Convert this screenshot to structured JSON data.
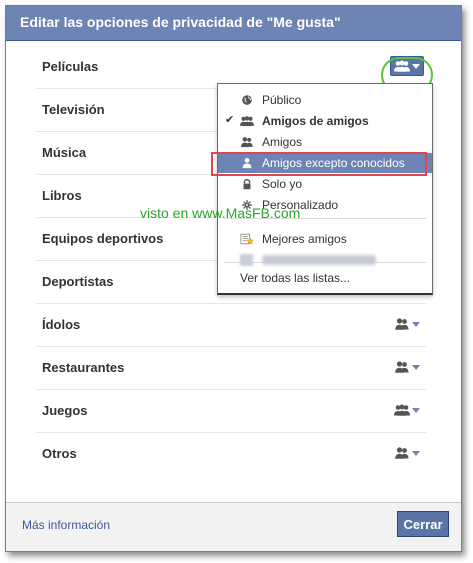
{
  "dialog": {
    "title": "Editar las opciones de privacidad de \"Me gusta\""
  },
  "rows": [
    {
      "label": "Películas",
      "icon": "friends-of-friends-icon"
    },
    {
      "label": "Televisión",
      "icon": "friends-of-friends-icon"
    },
    {
      "label": "Música",
      "icon": "friends-of-friends-icon"
    },
    {
      "label": "Libros",
      "icon": "friends-of-friends-icon"
    },
    {
      "label": "Equipos deportivos",
      "icon": "friends-of-friends-icon"
    },
    {
      "label": "Deportistas",
      "icon": "friends-of-friends-icon"
    },
    {
      "label": "Ídolos",
      "icon": "friends-icon"
    },
    {
      "label": "Restaurantes",
      "icon": "friends-icon"
    },
    {
      "label": "Juegos",
      "icon": "friends-of-friends-icon"
    },
    {
      "label": "Otros",
      "icon": "friends-icon"
    }
  ],
  "menu": {
    "items": [
      {
        "label": "Público",
        "icon": "globe-icon"
      },
      {
        "label": "Amigos de amigos",
        "icon": "friends-of-friends-icon",
        "checked": true
      },
      {
        "label": "Amigos",
        "icon": "friends-icon"
      },
      {
        "label": "Amigos excepto conocidos",
        "icon": "person-icon",
        "selected": true
      },
      {
        "label": "Solo yo",
        "icon": "lock-icon"
      },
      {
        "label": "Personalizado",
        "icon": "gear-icon"
      },
      {
        "label": "Mejores amigos",
        "icon": "star-list-icon"
      }
    ],
    "see_all": "Ver todas las listas..."
  },
  "watermark": "visto en www.MasFB.com",
  "footer": {
    "more_info": "Más información",
    "close": "Cerrar"
  },
  "colors": {
    "header": "#6d84b4",
    "accent": "#3b5998",
    "highlight_box": "#e0474c",
    "annotation": "#59c43a"
  }
}
